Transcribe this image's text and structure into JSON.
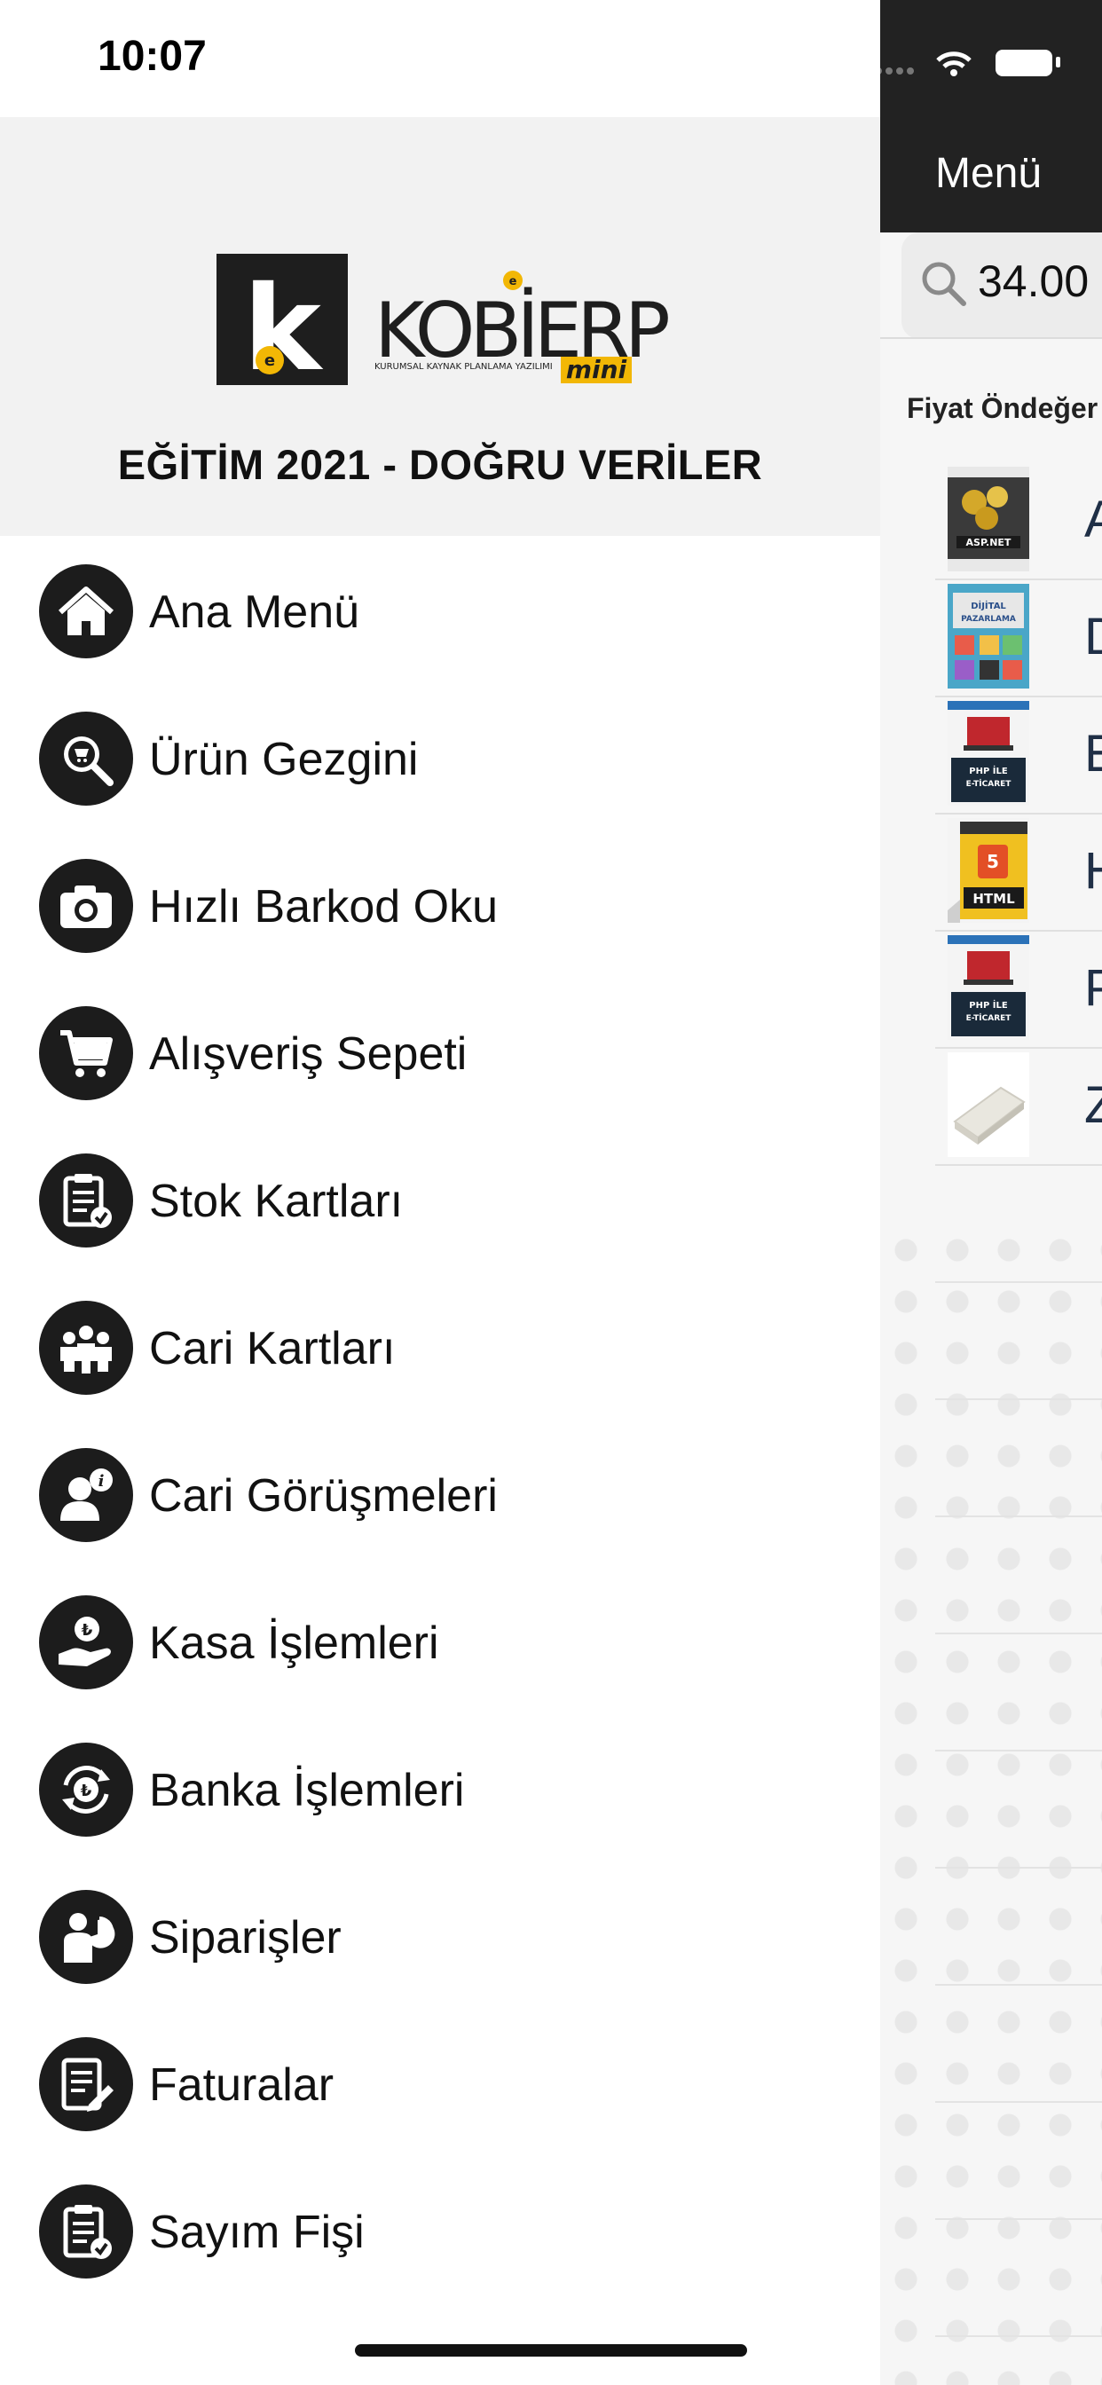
{
  "status_bar": {
    "time": "10:07"
  },
  "navbar": {
    "title": "Menü"
  },
  "search": {
    "value": "34.00"
  },
  "filter_label": "Fiyat Öndeğer",
  "products": [
    {
      "letter": "A",
      "image": "aspnet-book-cover"
    },
    {
      "letter": "D",
      "image": "dijital-pazarlama-book-cover"
    },
    {
      "letter": "E",
      "image": "php-eticaret-book-cover"
    },
    {
      "letter": "H",
      "image": "html-book-cover"
    },
    {
      "letter": "P",
      "image": "php-eticaret-book-cover"
    },
    {
      "letter": "Z",
      "image": "barcode-reader-device"
    }
  ],
  "drawer": {
    "logo_main": "KOBİERP",
    "logo_sub": "KURUMSAL KAYNAK PLANLAMA YAZILIMI",
    "logo_tag": "mini",
    "company": "EĞİTİM 2021 - DOĞRU VERİLER",
    "items": [
      {
        "label": "Ana Menü",
        "icon": "home-icon"
      },
      {
        "label": "Ürün Gezgini",
        "icon": "product-search-icon"
      },
      {
        "label": "Hızlı Barkod Oku",
        "icon": "camera-icon"
      },
      {
        "label": "Alışveriş Sepeti",
        "icon": "cart-icon"
      },
      {
        "label": "Stok Kartları",
        "icon": "clipboard-check-icon"
      },
      {
        "label": "Cari Kartları",
        "icon": "people-icon"
      },
      {
        "label": "Cari Görüşmeleri",
        "icon": "person-info-icon"
      },
      {
        "label": "Kasa İşlemleri",
        "icon": "hand-lira-icon"
      },
      {
        "label": "Banka İşlemleri",
        "icon": "lira-exchange-icon"
      },
      {
        "label": "Siparişler",
        "icon": "order-chart-icon"
      },
      {
        "label": "Faturalar",
        "icon": "invoice-icon"
      },
      {
        "label": "Sayım Fişi",
        "icon": "clipboard-check-icon"
      }
    ]
  },
  "colors": {
    "navbar": "#222222",
    "icon_circle": "#1c1c1c",
    "logo_accent": "#f2b705"
  }
}
